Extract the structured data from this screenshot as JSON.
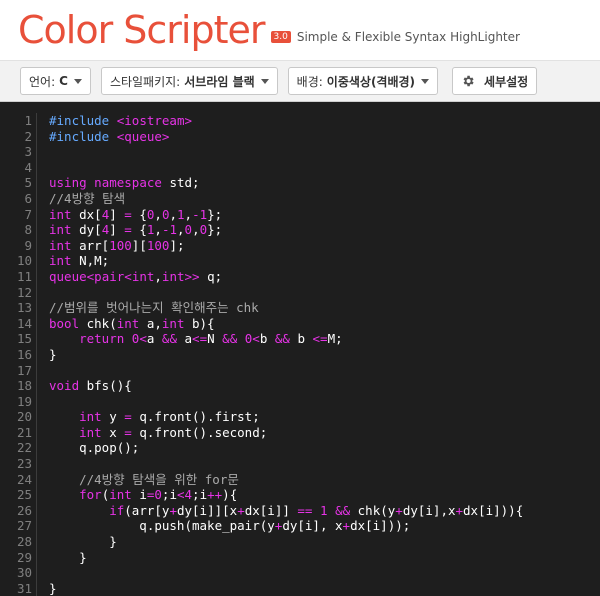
{
  "header": {
    "logo_text": "Color Scripter",
    "version": "3.0",
    "tagline": "Simple & Flexible Syntax HighLighter"
  },
  "toolbar": {
    "language_label": "언어:",
    "language_value": "C",
    "style_label": "스타일패키지:",
    "style_value": "서브라임 블랙",
    "background_label": "배경:",
    "background_value": "이중색상(격배경)",
    "settings_label": "세부설정"
  },
  "colors": {
    "brand": "#e8503a",
    "editor_bg": "#1e1e1e",
    "keyword": "#e633e6",
    "preprocessor": "#66aaff",
    "comment": "#aaaaaa",
    "text": "#ffffff"
  },
  "code": {
    "lines": [
      "#include <iostream>",
      "#include <queue>",
      "",
      "",
      "using namespace std;",
      "//4방향 탐색",
      "int dx[4] = {0,0,1,-1};",
      "int dy[4] = {1,-1,0,0};",
      "int arr[100][100];",
      "int N,M;",
      "queue<pair<int,int>> q;",
      "",
      "//범위를 벗어나는지 확인해주는 chk",
      "bool chk(int a,int b){",
      "    return 0<a && a<=N && 0<b && b <=M;",
      "}",
      "",
      "void bfs(){",
      "",
      "    int y = q.front().first;",
      "    int x = q.front().second;",
      "    q.pop();",
      "",
      "    //4방향 탐색을 위한 for문",
      "    for(int i=0;i<4;i++){",
      "        if(arr[y+dy[i]][x+dx[i]] == 1 && chk(y+dy[i],x+dx[i])){",
      "            q.push(make_pair(y+dy[i], x+dx[i]));",
      "        }",
      "    }",
      "",
      "}"
    ]
  }
}
